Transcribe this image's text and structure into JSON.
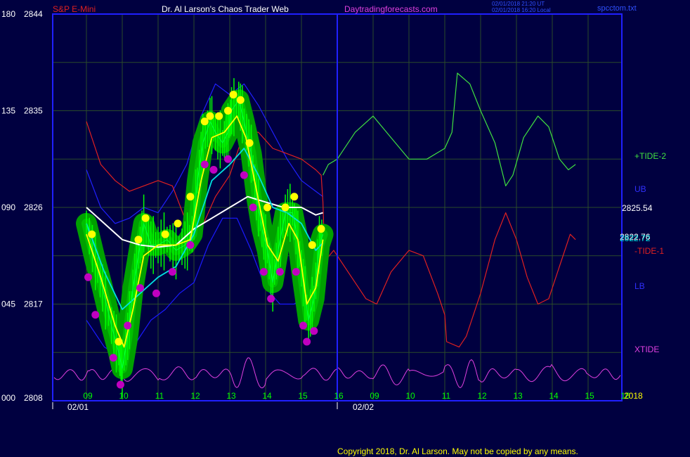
{
  "header": {
    "instrument": "S&P E-Mini",
    "title": "Dr. Al Larson's Chaos Trader Web",
    "site": "Daytradingforecasts.com",
    "timestamp_line1": "02/01/2018 21:20 UT",
    "timestamp_line2": "02/01/2018 16:20 Local",
    "filename": "spcctom.txt"
  },
  "footer": {
    "copyright": "Copyright 2018, Dr. Al Larson. May not be copied by any means."
  },
  "colors": {
    "background": "#000040",
    "frame": "#2020ff",
    "grid": "#2a4a2a",
    "price_bars": "#00ff00",
    "band": "#00a000",
    "high_dots": "#ffff00",
    "low_dots": "#c000c0",
    "ma_short": "#ffff00",
    "ma_mid": "#00e0e0",
    "ma_long": "#ffffff",
    "tide_plus": "#40e040",
    "tide_minus": "#e02020",
    "ub": "#2020ff",
    "lb": "#1a1aff",
    "xtide": "#e040e0"
  },
  "chart_data": {
    "type": "line",
    "y_axis": {
      "ticks": [
        {
          "left": "000",
          "right": "2808",
          "price": 2808
        },
        {
          "left": "045",
          "right": "2817",
          "price": 2817
        },
        {
          "left": "090",
          "right": "2826",
          "price": 2826
        },
        {
          "left": "135",
          "right": "2835",
          "price": 2835
        },
        {
          "left": "180",
          "right": "2844",
          "price": 2844
        }
      ],
      "range": [
        2808,
        2844
      ]
    },
    "x_axis": {
      "hour_labels": [
        "09",
        "10",
        "11",
        "12",
        "13",
        "14",
        "15",
        "16",
        "09",
        "10",
        "11",
        "12",
        "13",
        "14",
        "15",
        "16"
      ],
      "date_labels": [
        "02/01",
        "02/02"
      ],
      "year_label": "2018"
    },
    "series_labels": [
      {
        "key": "tide_plus",
        "text": "+TIDE-2"
      },
      {
        "key": "ub",
        "text": "UB"
      },
      {
        "key": "tide_minus",
        "text": "-TIDE-1"
      },
      {
        "key": "lb",
        "text": "LB"
      },
      {
        "key": "xtide",
        "text": "XTIDE"
      }
    ],
    "value_labels": [
      "2825.54",
      "2822.76",
      "2822.72"
    ],
    "price_path": [
      [
        0.0,
        2824.5
      ],
      [
        0.25,
        2821.0
      ],
      [
        0.45,
        2818.5
      ],
      [
        0.7,
        2815.0
      ],
      [
        0.9,
        2812.5
      ],
      [
        1.0,
        2811.0
      ],
      [
        1.15,
        2814.0
      ],
      [
        1.3,
        2818.5
      ],
      [
        1.45,
        2821.5
      ],
      [
        1.6,
        2824.5
      ],
      [
        1.8,
        2822.5
      ],
      [
        2.0,
        2822.5
      ],
      [
        2.25,
        2823.0
      ],
      [
        2.5,
        2822.0
      ],
      [
        2.75,
        2822.5
      ],
      [
        2.95,
        2823.5
      ],
      [
        3.1,
        2828.5
      ],
      [
        3.25,
        2832.0
      ],
      [
        3.45,
        2834.0
      ],
      [
        3.6,
        2833.0
      ],
      [
        3.8,
        2832.0
      ],
      [
        3.95,
        2833.0
      ],
      [
        4.05,
        2835.0
      ],
      [
        4.25,
        2836.0
      ],
      [
        4.4,
        2834.0
      ],
      [
        4.6,
        2831.0
      ],
      [
        4.75,
        2827.0
      ],
      [
        4.9,
        2824.0
      ],
      [
        5.05,
        2822.0
      ],
      [
        5.2,
        2819.0
      ],
      [
        5.35,
        2822.0
      ],
      [
        5.55,
        2825.5
      ],
      [
        5.75,
        2825.5
      ],
      [
        5.9,
        2823.0
      ],
      [
        6.05,
        2819.0
      ],
      [
        6.2,
        2815.5
      ],
      [
        6.35,
        2817.5
      ],
      [
        6.5,
        2822.5
      ],
      [
        6.6,
        2823.5
      ]
    ],
    "highs": [
      [
        0.15,
        2823.5
      ],
      [
        0.9,
        2813.5
      ],
      [
        1.45,
        2823.0
      ],
      [
        1.65,
        2825.0
      ],
      [
        2.2,
        2823.5
      ],
      [
        2.55,
        2824.5
      ],
      [
        2.9,
        2827.0
      ],
      [
        3.3,
        2834.0
      ],
      [
        3.45,
        2834.5
      ],
      [
        3.7,
        2834.5
      ],
      [
        3.95,
        2835.0
      ],
      [
        4.1,
        2836.5
      ],
      [
        4.3,
        2836.0
      ],
      [
        4.55,
        2832.0
      ],
      [
        5.05,
        2826.0
      ],
      [
        5.55,
        2826.0
      ],
      [
        5.8,
        2827.0
      ],
      [
        6.3,
        2822.5
      ],
      [
        6.55,
        2824.0
      ]
    ],
    "lows": [
      [
        0.05,
        2819.5
      ],
      [
        0.25,
        2816.0
      ],
      [
        0.75,
        2812.0
      ],
      [
        0.95,
        2809.5
      ],
      [
        1.15,
        2815.0
      ],
      [
        1.5,
        2818.5
      ],
      [
        1.95,
        2818.0
      ],
      [
        2.4,
        2820.0
      ],
      [
        2.9,
        2822.5
      ],
      [
        3.3,
        2830.0
      ],
      [
        3.55,
        2829.5
      ],
      [
        3.95,
        2830.5
      ],
      [
        4.4,
        2829.0
      ],
      [
        4.65,
        2826.0
      ],
      [
        4.95,
        2820.0
      ],
      [
        5.15,
        2817.5
      ],
      [
        5.4,
        2820.0
      ],
      [
        5.85,
        2820.0
      ],
      [
        6.05,
        2815.0
      ],
      [
        6.15,
        2813.5
      ],
      [
        6.35,
        2814.5
      ]
    ],
    "ma_short": [
      [
        0.0,
        2823.5
      ],
      [
        0.4,
        2819.5
      ],
      [
        0.8,
        2815.0
      ],
      [
        1.05,
        2813.0
      ],
      [
        1.3,
        2816.5
      ],
      [
        1.6,
        2821.5
      ],
      [
        2.0,
        2822.5
      ],
      [
        2.5,
        2822.5
      ],
      [
        2.9,
        2823.0
      ],
      [
        3.2,
        2828.5
      ],
      [
        3.5,
        2832.5
      ],
      [
        3.85,
        2833.0
      ],
      [
        4.2,
        2834.5
      ],
      [
        4.45,
        2832.5
      ],
      [
        4.75,
        2827.5
      ],
      [
        5.05,
        2822.5
      ],
      [
        5.35,
        2821.0
      ],
      [
        5.65,
        2824.5
      ],
      [
        5.9,
        2823.0
      ],
      [
        6.15,
        2817.0
      ],
      [
        6.4,
        2818.5
      ],
      [
        6.6,
        2823.0
      ]
    ],
    "ma_mid": [
      [
        0.0,
        2824.5
      ],
      [
        0.5,
        2820.0
      ],
      [
        1.0,
        2816.5
      ],
      [
        1.5,
        2818.0
      ],
      [
        2.0,
        2819.5
      ],
      [
        2.5,
        2820.5
      ],
      [
        3.0,
        2823.5
      ],
      [
        3.5,
        2828.5
      ],
      [
        4.0,
        2830.0
      ],
      [
        4.4,
        2831.5
      ],
      [
        4.8,
        2829.0
      ],
      [
        5.2,
        2826.0
      ],
      [
        5.6,
        2825.5
      ],
      [
        6.0,
        2824.5
      ],
      [
        6.4,
        2822.0
      ],
      [
        6.6,
        2822.7
      ]
    ],
    "ma_long": [
      [
        0.0,
        2826.0
      ],
      [
        0.5,
        2824.5
      ],
      [
        1.0,
        2823.0
      ],
      [
        1.5,
        2822.5
      ],
      [
        2.0,
        2822.3
      ],
      [
        2.5,
        2822.5
      ],
      [
        3.0,
        2824.0
      ],
      [
        3.5,
        2825.0
      ],
      [
        4.0,
        2826.0
      ],
      [
        4.5,
        2827.0
      ],
      [
        5.0,
        2826.5
      ],
      [
        5.5,
        2826.0
      ],
      [
        6.0,
        2826.0
      ],
      [
        6.4,
        2825.3
      ],
      [
        6.6,
        2825.5
      ]
    ],
    "ub": [
      [
        0.0,
        2829.5
      ],
      [
        0.4,
        2826.0
      ],
      [
        0.8,
        2824.5
      ],
      [
        1.2,
        2825.0
      ],
      [
        1.6,
        2826.0
      ],
      [
        2.0,
        2825.5
      ],
      [
        2.4,
        2827.5
      ],
      [
        2.8,
        2830.0
      ],
      [
        3.2,
        2834.5
      ],
      [
        3.6,
        2837.5
      ],
      [
        4.0,
        2836.5
      ],
      [
        4.4,
        2837.5
      ],
      [
        4.8,
        2835.5
      ],
      [
        5.2,
        2833.0
      ],
      [
        5.6,
        2830.5
      ],
      [
        6.0,
        2828.5
      ],
      [
        6.4,
        2827.5
      ],
      [
        6.6,
        2827.0
      ]
    ],
    "lb": [
      [
        0.0,
        2815.5
      ],
      [
        0.5,
        2813.0
      ],
      [
        1.0,
        2812.0
      ],
      [
        1.4,
        2813.5
      ],
      [
        1.8,
        2815.5
      ],
      [
        2.2,
        2816.5
      ],
      [
        2.6,
        2818.0
      ],
      [
        3.0,
        2819.0
      ],
      [
        3.4,
        2822.5
      ],
      [
        3.8,
        2825.0
      ],
      [
        4.2,
        2825.0
      ],
      [
        4.6,
        2822.0
      ],
      [
        5.0,
        2818.5
      ],
      [
        5.4,
        2817.0
      ],
      [
        5.8,
        2817.0
      ],
      [
        6.2,
        2818.0
      ],
      [
        6.6,
        2819.0
      ]
    ],
    "tide_minus": [
      [
        0.0,
        2834.0
      ],
      [
        0.4,
        2830.0
      ],
      [
        0.8,
        2828.5
      ],
      [
        1.2,
        2827.5
      ],
      [
        1.6,
        2828.0
      ],
      [
        2.0,
        2828.5
      ],
      [
        2.4,
        2828.0
      ],
      [
        2.8,
        2824.5
      ],
      [
        3.2,
        2824.0
      ],
      [
        3.6,
        2827.0
      ],
      [
        4.0,
        2829.0
      ],
      [
        4.4,
        2833.0
      ],
      [
        4.8,
        2833.0
      ],
      [
        5.2,
        2831.5
      ],
      [
        5.6,
        2831.0
      ],
      [
        6.0,
        2830.5
      ],
      [
        6.4,
        2829.5
      ],
      [
        6.55,
        2829.0
      ],
      [
        6.6,
        2826.5
      ],
      [
        6.65,
        2821.0
      ],
      [
        6.9,
        2822.0
      ],
      [
        7.3,
        2820.0
      ],
      [
        7.8,
        2817.5
      ],
      [
        8.1,
        2817.0
      ],
      [
        8.5,
        2820.0
      ],
      [
        9.0,
        2822.0
      ],
      [
        9.4,
        2821.5
      ],
      [
        9.8,
        2818.0
      ],
      [
        10.0,
        2816.0
      ],
      [
        10.05,
        2813.5
      ],
      [
        10.4,
        2813.0
      ],
      [
        10.6,
        2814.0
      ],
      [
        11.0,
        2818.0
      ],
      [
        11.4,
        2823.0
      ],
      [
        11.7,
        2825.5
      ],
      [
        12.0,
        2823.0
      ],
      [
        12.3,
        2819.5
      ],
      [
        12.6,
        2817.0
      ],
      [
        12.9,
        2817.5
      ],
      [
        13.2,
        2820.5
      ],
      [
        13.5,
        2823.5
      ],
      [
        13.65,
        2823.0
      ]
    ],
    "tide_plus": [
      [
        6.6,
        2829.0
      ],
      [
        6.75,
        2830.0
      ],
      [
        7.0,
        2830.5
      ],
      [
        7.5,
        2833.0
      ],
      [
        8.0,
        2834.5
      ],
      [
        8.5,
        2832.5
      ],
      [
        9.0,
        2830.5
      ],
      [
        9.5,
        2830.5
      ],
      [
        10.0,
        2831.5
      ],
      [
        10.2,
        2833.0
      ],
      [
        10.35,
        2838.5
      ],
      [
        10.7,
        2837.5
      ],
      [
        11.0,
        2835.0
      ],
      [
        11.4,
        2832.0
      ],
      [
        11.7,
        2828.0
      ],
      [
        11.9,
        2829.0
      ],
      [
        12.2,
        2832.5
      ],
      [
        12.6,
        2834.5
      ],
      [
        12.9,
        2833.5
      ],
      [
        13.2,
        2830.5
      ],
      [
        13.45,
        2829.5
      ],
      [
        13.65,
        2830.0
      ]
    ],
    "xtide_amp": [
      0.6,
      0.3,
      0.7,
      0.4,
      0.5,
      0.9,
      0.5,
      0.35,
      0.45,
      0.6,
      0.3,
      0.8,
      0.55,
      0.45,
      0.7,
      0.3
    ]
  }
}
